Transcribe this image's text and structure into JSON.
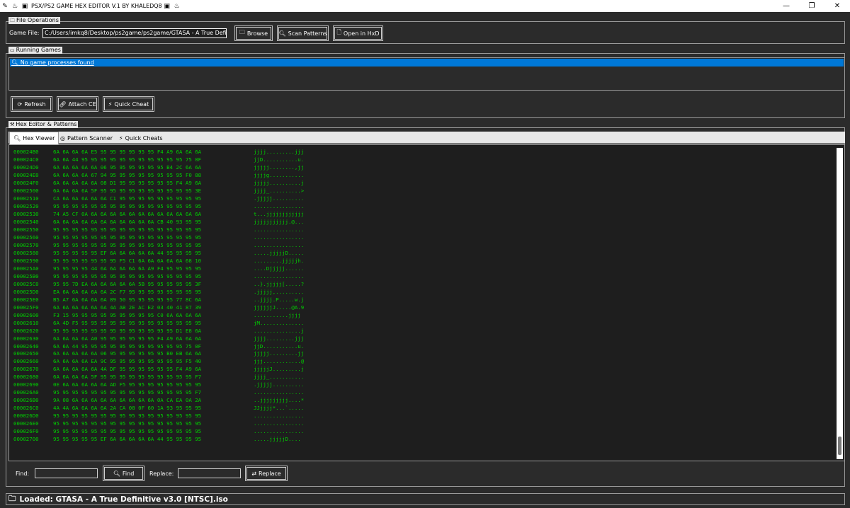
{
  "window": {
    "title": "PSX/PS2 GAME HEX EDITOR V.1 BY KHALEDQ8",
    "controls": [
      "—",
      "❐",
      "✕"
    ]
  },
  "file_ops": {
    "label": "File Operations",
    "game_file_label": "Game File:",
    "game_file_value": "C:/Users/imkq8/Desktop/ps2game/ps2game/GTASA - A True Definit",
    "browse": "Browse",
    "scan": "Scan Patterns",
    "open_hxd": "Open in HxD"
  },
  "running": {
    "label": "Running Games",
    "item": "No game processes found",
    "refresh": "Refresh",
    "attach": "Attach CE",
    "quick_cheat": "Quick Cheat"
  },
  "hex_section": {
    "label": "Hex Editor & Patterns",
    "tabs": [
      "Hex Viewer",
      "Pattern Scanner",
      "Quick Cheats"
    ]
  },
  "hex_rows": [
    {
      "a": "000024B0",
      "b": "6A 6A 6A 6A E5 95 95 95 95 95 95 F4 A9 6A 6A 6A",
      "t": "jjjj.........jjj"
    },
    {
      "a": "000024C0",
      "b": "6A 6A 44 95 95 95 95 95 95 95 95 95 95 95 75 0F",
      "t": "jjD...........u."
    },
    {
      "a": "000024D0",
      "b": "6A 6A 6A 6A 6A 06 95 95 95 95 95 95 B4 2C 6A 6A",
      "t": "jjjjj........,jj"
    },
    {
      "a": "000024E0",
      "b": "6A 6A 6A 6A 67 94 95 95 95 95 95 95 95 95 F0 88",
      "t": "jjjjg..........."
    },
    {
      "a": "000024F0",
      "b": "6A 6A 6A 6A 6A 08 D1 95 95 95 95 95 95 F4 A9 6A",
      "t": "jjjjj..........j"
    },
    {
      "a": "00002500",
      "b": "6A 6A 6A 6A 5F 95 95 95 95 95 95 95 95 95 95 3E",
      "t": "jjjj_..........>"
    },
    {
      "a": "00002510",
      "b": "CA 6A 6A 6A 6A 6A C1 95 95 95 95 95 95 95 95 95",
      "t": ".jjjjj.........."
    },
    {
      "a": "00002520",
      "b": "95 95 95 95 95 95 95 95 95 95 95 95 95 95 95 95",
      "t": "................"
    },
    {
      "a": "00002530",
      "b": "74 A5 CF 0A 6A 6A 6A 6A 6A 6A 6A 6A 6A 6A 6A 6A",
      "t": "t...jjjjjjjjjjjj"
    },
    {
      "a": "00002540",
      "b": "6A 6A 6A 6A 6A 6A 6A 6A 6A 6A 6A CB 40 93 95 95",
      "t": "jjjjjjjjjjj.@..."
    },
    {
      "a": "00002550",
      "b": "95 95 95 95 95 95 95 95 95 95 95 95 95 95 95 95",
      "t": "................"
    },
    {
      "a": "00002560",
      "b": "95 95 95 95 95 95 95 95 95 95 95 95 95 95 95 95",
      "t": "................"
    },
    {
      "a": "00002570",
      "b": "95 95 95 95 95 95 95 95 95 95 95 95 95 95 95 95",
      "t": "................"
    },
    {
      "a": "00002580",
      "b": "95 95 95 95 95 EF 6A 6A 6A 6A 6A 44 95 95 95 95",
      "t": ".....jjjjjD....."
    },
    {
      "a": "00002590",
      "b": "95 95 95 95 95 95 95 F5 C1 6A 6A 6A 6A 6A 68 10",
      "t": ".........jjjjjh."
    },
    {
      "a": "000025A0",
      "b": "95 95 95 95 44 6A 6A 6A 6A 6A A9 F4 95 95 95 95",
      "t": "....Djjjjj......"
    },
    {
      "a": "000025B0",
      "b": "95 95 95 95 95 95 95 95 95 95 95 95 95 95 95 95",
      "t": "................"
    },
    {
      "a": "000025C0",
      "b": "95 95 7D EA 6A 6A 6A 6A 6A 5B 95 95 95 95 95 3F",
      "t": "..}.jjjjj[.....?"
    },
    {
      "a": "000025D0",
      "b": "EA 6A 6A 6A 6A 6A 2C F7 95 95 95 95 95 95 95 95",
      "t": ".jjjjj,........."
    },
    {
      "a": "000025E0",
      "b": "B5 A7 6A 6A 6A 6A 89 50 95 95 95 95 95 77 8C 6A",
      "t": "..jjjj.P.....w.j"
    },
    {
      "a": "000025F0",
      "b": "6A 6A 6A 6A 6A 6A 4A AB 2E AC E2 03 40 41 87 39",
      "t": "jjjjjjJ.....@A.9"
    },
    {
      "a": "00002600",
      "b": "F3 15 95 95 95 95 95 95 95 95 95 C0 6A 6A 6A 6A",
      "t": "...........jjjj"
    },
    {
      "a": "00002610",
      "b": "6A 4D F5 95 95 95 95 95 95 95 95 95 95 95 95 95",
      "t": "jM.............."
    },
    {
      "a": "00002620",
      "b": "95 95 95 95 95 95 95 95 95 95 95 95 95 D1 E8 6A",
      "t": "...............j"
    },
    {
      "a": "00002630",
      "b": "6A 6A 6A 6A A0 95 95 95 95 95 95 F4 A9 6A 6A 6A",
      "t": "jjjj.........jjj"
    },
    {
      "a": "00002640",
      "b": "6A 6A 44 95 95 95 95 95 95 95 95 95 95 95 75 0F",
      "t": "jjD...........u."
    },
    {
      "a": "00002650",
      "b": "6A 6A 6A 6A 6A 06 95 95 95 95 95 95 B0 EB 6A 6A",
      "t": "jjjjj.........jj"
    },
    {
      "a": "00002660",
      "b": "6A 6A 6A 6A EA 9C 95 95 95 95 95 95 95 95 F5 40",
      "t": "jjj............@"
    },
    {
      "a": "00002670",
      "b": "6A 6A 6A 6A 6A 4A DF 95 95 95 95 95 95 F4 A9 6A",
      "t": "jjjjjJ.........j"
    },
    {
      "a": "00002680",
      "b": "6A 6A 6A 6A 5F 95 95 95 95 95 95 95 95 95 95 F7",
      "t": "jjjj_..........."
    },
    {
      "a": "00002690",
      "b": "0E 6A 6A 6A 6A 6A AD F5 95 95 95 95 95 95 95 95",
      "t": ".jjjjj.........."
    },
    {
      "a": "000026A0",
      "b": "95 95 95 95 95 95 95 95 95 95 95 95 95 95 95 F7",
      "t": "................"
    },
    {
      "a": "000026B0",
      "b": "9A 08 6A 6A 6A 6A 6A 6A 6A 6A 6A 0A CA EA 0A 2A",
      "t": "..jjjjjjjjj....*"
    },
    {
      "a": "000026C0",
      "b": "4A 4A 6A 6A 6A 6A 2A CA 08 0F 60 1A 93 95 95 95",
      "t": "JJjjjj*...`....."
    },
    {
      "a": "000026D0",
      "b": "95 95 95 95 95 95 95 95 95 95 95 95 95 95 95 95",
      "t": "................"
    },
    {
      "a": "000026E0",
      "b": "95 95 95 95 95 95 95 95 95 95 95 95 95 95 95 95",
      "t": "................"
    },
    {
      "a": "000026F0",
      "b": "95 95 95 95 95 95 95 95 95 95 95 95 95 95 95 95",
      "t": "................"
    },
    {
      "a": "00002700",
      "b": "95 95 95 95 95 EF 6A 6A 6A 6A 6A 44 95 95 95 95",
      "t": ".....jjjjjD...."
    }
  ],
  "search": {
    "find_label": "Find:",
    "find_value": "",
    "find_button": "Find",
    "replace_label": "Replace:",
    "replace_value": "",
    "replace_button": "Replace"
  },
  "status": {
    "text": "Loaded: GTASA - A True Definitive v3.0 [NTSC].iso"
  }
}
